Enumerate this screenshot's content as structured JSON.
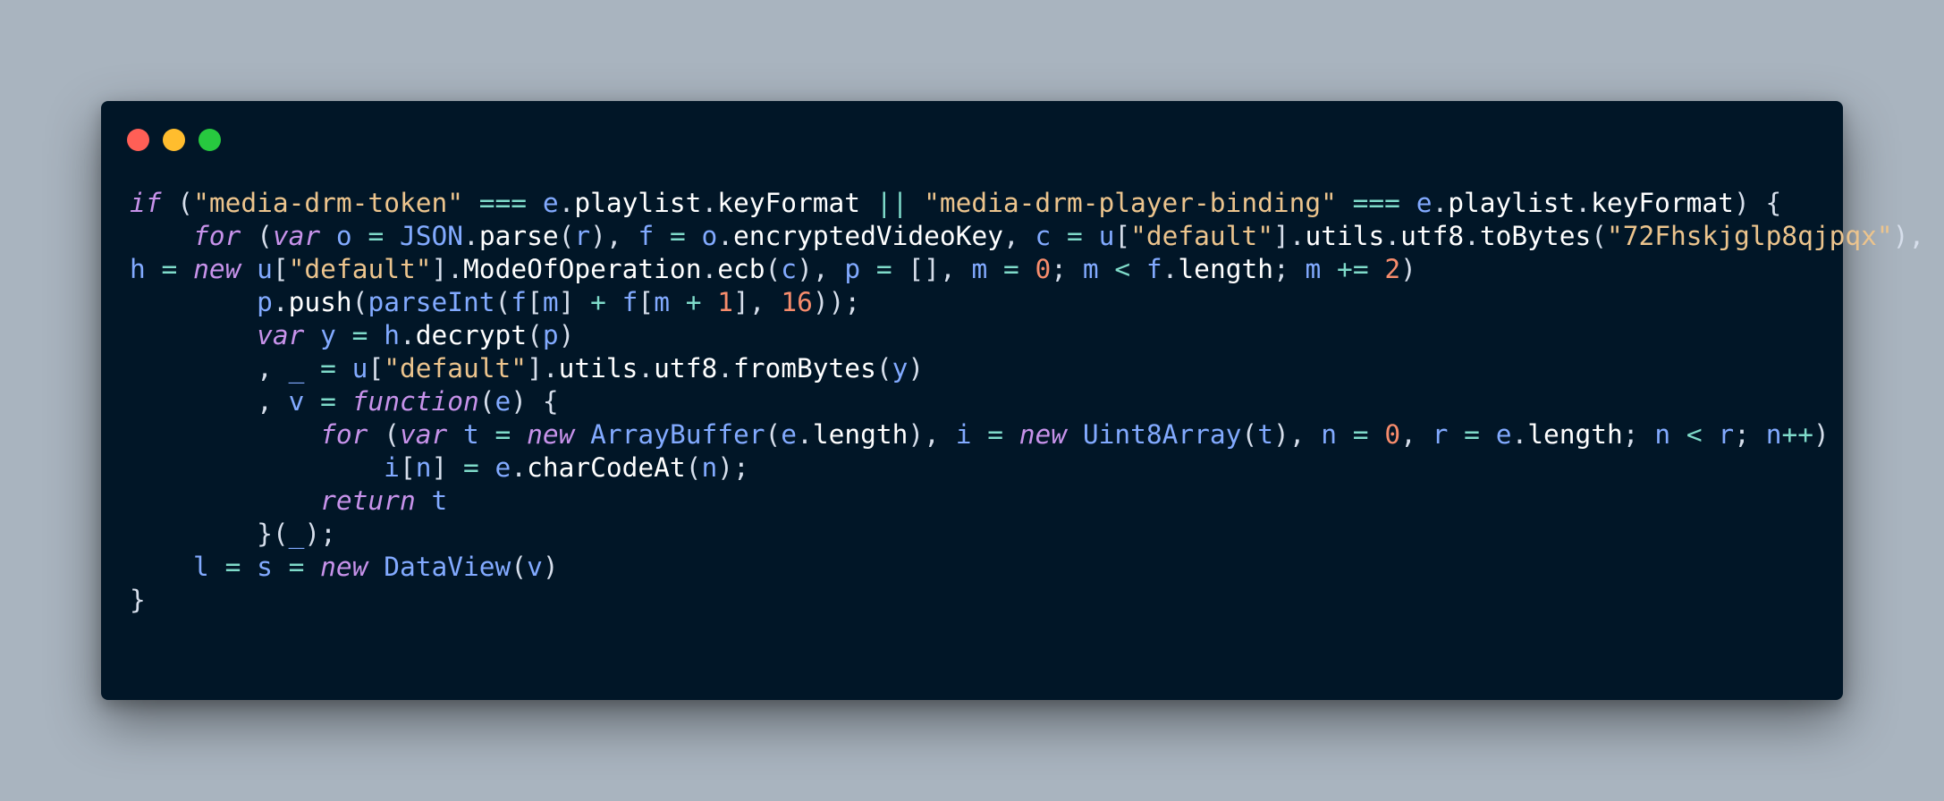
{
  "window": {
    "controls": [
      "close",
      "minimize",
      "maximize"
    ],
    "colors": {
      "background": "#011627",
      "page_background": "#a9b4bf",
      "close": "#ff5f56",
      "minimize": "#ffbd2e",
      "maximize": "#27c93f"
    }
  },
  "code": {
    "language": "javascript",
    "theme": "night-owl",
    "lines": [
      [
        {
          "t": "if",
          "k": "kw"
        },
        {
          "t": " (",
          "k": "punc"
        },
        {
          "t": "\"media-drm-token\"",
          "k": "str"
        },
        {
          "t": " === ",
          "k": "op"
        },
        {
          "t": "e",
          "k": "var"
        },
        {
          "t": ".",
          "k": "punc"
        },
        {
          "t": "playlist",
          "k": "prop"
        },
        {
          "t": ".",
          "k": "punc"
        },
        {
          "t": "keyFormat",
          "k": "prop"
        },
        {
          "t": " || ",
          "k": "op"
        },
        {
          "t": "\"media-drm-player-binding\"",
          "k": "str"
        },
        {
          "t": " === ",
          "k": "op"
        },
        {
          "t": "e",
          "k": "var"
        },
        {
          "t": ".",
          "k": "punc"
        },
        {
          "t": "playlist",
          "k": "prop"
        },
        {
          "t": ".",
          "k": "punc"
        },
        {
          "t": "keyFormat",
          "k": "prop"
        },
        {
          "t": ") {",
          "k": "punc"
        }
      ],
      [
        {
          "t": "    ",
          "k": "punc"
        },
        {
          "t": "for",
          "k": "kw"
        },
        {
          "t": " (",
          "k": "punc"
        },
        {
          "t": "var",
          "k": "kw"
        },
        {
          "t": " o",
          "k": "var"
        },
        {
          "t": " = ",
          "k": "op"
        },
        {
          "t": "JSON",
          "k": "cls"
        },
        {
          "t": ".",
          "k": "punc"
        },
        {
          "t": "parse",
          "k": "prop"
        },
        {
          "t": "(",
          "k": "punc"
        },
        {
          "t": "r",
          "k": "var"
        },
        {
          "t": "), ",
          "k": "punc"
        },
        {
          "t": "f",
          "k": "var"
        },
        {
          "t": " = ",
          "k": "op"
        },
        {
          "t": "o",
          "k": "var"
        },
        {
          "t": ".",
          "k": "punc"
        },
        {
          "t": "encryptedVideoKey",
          "k": "prop"
        },
        {
          "t": ", ",
          "k": "punc"
        },
        {
          "t": "c",
          "k": "var"
        },
        {
          "t": " = ",
          "k": "op"
        },
        {
          "t": "u",
          "k": "var"
        },
        {
          "t": "[",
          "k": "punc"
        },
        {
          "t": "\"default\"",
          "k": "str"
        },
        {
          "t": "].",
          "k": "punc"
        },
        {
          "t": "utils",
          "k": "prop"
        },
        {
          "t": ".",
          "k": "punc"
        },
        {
          "t": "utf8",
          "k": "prop"
        },
        {
          "t": ".",
          "k": "punc"
        },
        {
          "t": "toBytes",
          "k": "prop"
        },
        {
          "t": "(",
          "k": "punc"
        },
        {
          "t": "\"72Fhskjglp8qjpqx\"",
          "k": "str"
        },
        {
          "t": "),",
          "k": "punc"
        }
      ],
      [
        {
          "t": "h",
          "k": "var"
        },
        {
          "t": " = ",
          "k": "op"
        },
        {
          "t": "new",
          "k": "kw"
        },
        {
          "t": " u",
          "k": "var"
        },
        {
          "t": "[",
          "k": "punc"
        },
        {
          "t": "\"default\"",
          "k": "str"
        },
        {
          "t": "].",
          "k": "punc"
        },
        {
          "t": "ModeOfOperation",
          "k": "prop"
        },
        {
          "t": ".",
          "k": "punc"
        },
        {
          "t": "ecb",
          "k": "prop"
        },
        {
          "t": "(",
          "k": "punc"
        },
        {
          "t": "c",
          "k": "var"
        },
        {
          "t": "), ",
          "k": "punc"
        },
        {
          "t": "p",
          "k": "var"
        },
        {
          "t": " = ",
          "k": "op"
        },
        {
          "t": "[], ",
          "k": "punc"
        },
        {
          "t": "m",
          "k": "var"
        },
        {
          "t": " = ",
          "k": "op"
        },
        {
          "t": "0",
          "k": "num"
        },
        {
          "t": "; ",
          "k": "punc"
        },
        {
          "t": "m",
          "k": "var"
        },
        {
          "t": " < ",
          "k": "op"
        },
        {
          "t": "f",
          "k": "var"
        },
        {
          "t": ".",
          "k": "punc"
        },
        {
          "t": "length",
          "k": "prop"
        },
        {
          "t": "; ",
          "k": "punc"
        },
        {
          "t": "m",
          "k": "var"
        },
        {
          "t": " += ",
          "k": "op"
        },
        {
          "t": "2",
          "k": "num"
        },
        {
          "t": ")",
          "k": "punc"
        }
      ],
      [
        {
          "t": "        ",
          "k": "punc"
        },
        {
          "t": "p",
          "k": "var"
        },
        {
          "t": ".",
          "k": "punc"
        },
        {
          "t": "push",
          "k": "prop"
        },
        {
          "t": "(",
          "k": "punc"
        },
        {
          "t": "parseInt",
          "k": "cls"
        },
        {
          "t": "(",
          "k": "punc"
        },
        {
          "t": "f",
          "k": "var"
        },
        {
          "t": "[",
          "k": "punc"
        },
        {
          "t": "m",
          "k": "var"
        },
        {
          "t": "] ",
          "k": "punc"
        },
        {
          "t": "+ ",
          "k": "op"
        },
        {
          "t": "f",
          "k": "var"
        },
        {
          "t": "[",
          "k": "punc"
        },
        {
          "t": "m",
          "k": "var"
        },
        {
          "t": " + ",
          "k": "op"
        },
        {
          "t": "1",
          "k": "num"
        },
        {
          "t": "], ",
          "k": "punc"
        },
        {
          "t": "16",
          "k": "num"
        },
        {
          "t": "));",
          "k": "punc"
        }
      ],
      [
        {
          "t": "        ",
          "k": "punc"
        },
        {
          "t": "var",
          "k": "kw"
        },
        {
          "t": " y",
          "k": "var"
        },
        {
          "t": " = ",
          "k": "op"
        },
        {
          "t": "h",
          "k": "var"
        },
        {
          "t": ".",
          "k": "punc"
        },
        {
          "t": "decrypt",
          "k": "prop"
        },
        {
          "t": "(",
          "k": "punc"
        },
        {
          "t": "p",
          "k": "var"
        },
        {
          "t": ")",
          "k": "punc"
        }
      ],
      [
        {
          "t": "        , ",
          "k": "punc"
        },
        {
          "t": "_",
          "k": "var"
        },
        {
          "t": " = ",
          "k": "op"
        },
        {
          "t": "u",
          "k": "var"
        },
        {
          "t": "[",
          "k": "punc"
        },
        {
          "t": "\"default\"",
          "k": "str"
        },
        {
          "t": "].",
          "k": "punc"
        },
        {
          "t": "utils",
          "k": "prop"
        },
        {
          "t": ".",
          "k": "punc"
        },
        {
          "t": "utf8",
          "k": "prop"
        },
        {
          "t": ".",
          "k": "punc"
        },
        {
          "t": "fromBytes",
          "k": "prop"
        },
        {
          "t": "(",
          "k": "punc"
        },
        {
          "t": "y",
          "k": "var"
        },
        {
          "t": ")",
          "k": "punc"
        }
      ],
      [
        {
          "t": "        , ",
          "k": "punc"
        },
        {
          "t": "v",
          "k": "var"
        },
        {
          "t": " = ",
          "k": "op"
        },
        {
          "t": "function",
          "k": "kw"
        },
        {
          "t": "(",
          "k": "punc"
        },
        {
          "t": "e",
          "k": "var"
        },
        {
          "t": ") {",
          "k": "punc"
        }
      ],
      [
        {
          "t": "            ",
          "k": "punc"
        },
        {
          "t": "for",
          "k": "kw"
        },
        {
          "t": " (",
          "k": "punc"
        },
        {
          "t": "var",
          "k": "kw"
        },
        {
          "t": " t",
          "k": "var"
        },
        {
          "t": " = ",
          "k": "op"
        },
        {
          "t": "new",
          "k": "kw"
        },
        {
          "t": " ArrayBuffer",
          "k": "cls"
        },
        {
          "t": "(",
          "k": "punc"
        },
        {
          "t": "e",
          "k": "var"
        },
        {
          "t": ".",
          "k": "punc"
        },
        {
          "t": "length",
          "k": "prop"
        },
        {
          "t": "), ",
          "k": "punc"
        },
        {
          "t": "i",
          "k": "var"
        },
        {
          "t": " = ",
          "k": "op"
        },
        {
          "t": "new",
          "k": "kw"
        },
        {
          "t": " Uint8Array",
          "k": "cls"
        },
        {
          "t": "(",
          "k": "punc"
        },
        {
          "t": "t",
          "k": "var"
        },
        {
          "t": "), ",
          "k": "punc"
        },
        {
          "t": "n",
          "k": "var"
        },
        {
          "t": " = ",
          "k": "op"
        },
        {
          "t": "0",
          "k": "num"
        },
        {
          "t": ", ",
          "k": "punc"
        },
        {
          "t": "r",
          "k": "var"
        },
        {
          "t": " = ",
          "k": "op"
        },
        {
          "t": "e",
          "k": "var"
        },
        {
          "t": ".",
          "k": "punc"
        },
        {
          "t": "length",
          "k": "prop"
        },
        {
          "t": "; ",
          "k": "punc"
        },
        {
          "t": "n",
          "k": "var"
        },
        {
          "t": " < ",
          "k": "op"
        },
        {
          "t": "r",
          "k": "var"
        },
        {
          "t": "; ",
          "k": "punc"
        },
        {
          "t": "n",
          "k": "var"
        },
        {
          "t": "++",
          "k": "op"
        },
        {
          "t": ")",
          "k": "punc"
        }
      ],
      [
        {
          "t": "                ",
          "k": "punc"
        },
        {
          "t": "i",
          "k": "var"
        },
        {
          "t": "[",
          "k": "punc"
        },
        {
          "t": "n",
          "k": "var"
        },
        {
          "t": "] ",
          "k": "punc"
        },
        {
          "t": "= ",
          "k": "op"
        },
        {
          "t": "e",
          "k": "var"
        },
        {
          "t": ".",
          "k": "punc"
        },
        {
          "t": "charCodeAt",
          "k": "prop"
        },
        {
          "t": "(",
          "k": "punc"
        },
        {
          "t": "n",
          "k": "var"
        },
        {
          "t": ");",
          "k": "punc"
        }
      ],
      [
        {
          "t": "            ",
          "k": "punc"
        },
        {
          "t": "return",
          "k": "kw"
        },
        {
          "t": " t",
          "k": "var"
        }
      ],
      [
        {
          "t": "        }(",
          "k": "punc"
        },
        {
          "t": "_",
          "k": "var"
        },
        {
          "t": ");",
          "k": "punc"
        }
      ],
      [
        {
          "t": "    ",
          "k": "punc"
        },
        {
          "t": "l",
          "k": "var"
        },
        {
          "t": " = ",
          "k": "op"
        },
        {
          "t": "s",
          "k": "var"
        },
        {
          "t": " = ",
          "k": "op"
        },
        {
          "t": "new",
          "k": "kw"
        },
        {
          "t": " DataView",
          "k": "cls"
        },
        {
          "t": "(",
          "k": "punc"
        },
        {
          "t": "v",
          "k": "var"
        },
        {
          "t": ")",
          "k": "punc"
        }
      ],
      [
        {
          "t": "}",
          "k": "punc"
        }
      ]
    ]
  }
}
